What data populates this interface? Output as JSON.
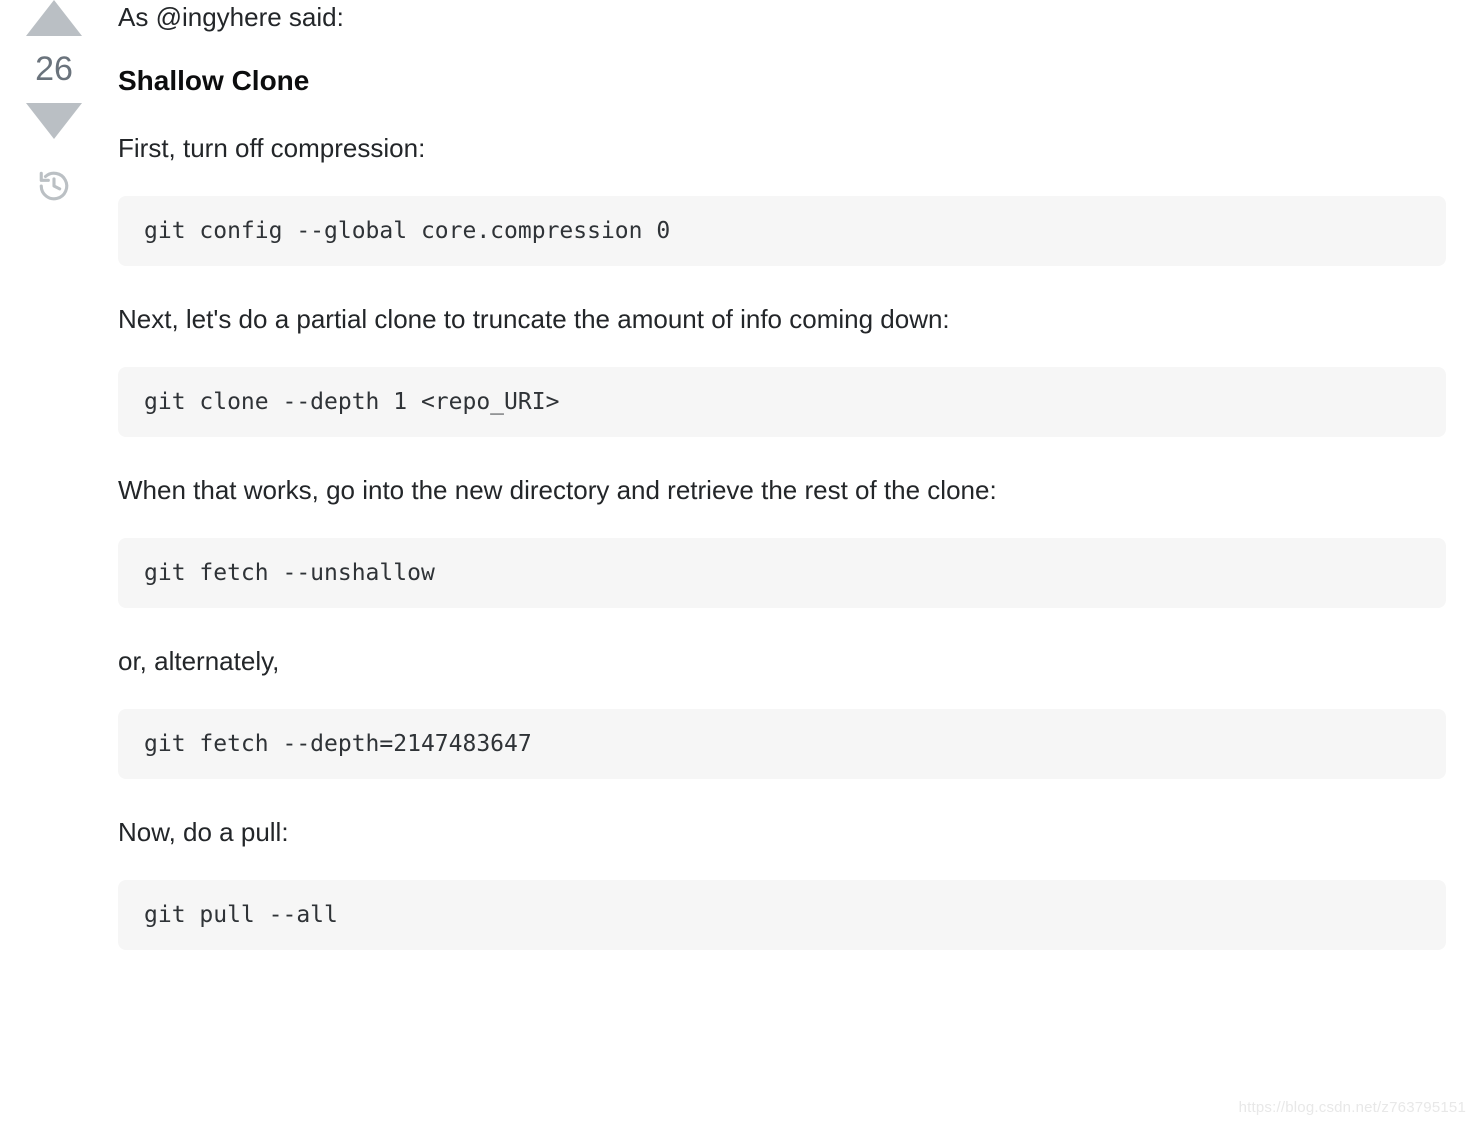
{
  "vote": {
    "count": "26"
  },
  "answer": {
    "intro": "As @ingyhere said:",
    "heading": "Shallow Clone",
    "p1": "First, turn off compression:",
    "code1": "git config --global core.compression 0",
    "p2": "Next, let's do a partial clone to truncate the amount of info coming down:",
    "code2": "git clone --depth 1 <repo_URI>",
    "p3": "When that works, go into the new directory and retrieve the rest of the clone:",
    "code3": "git fetch --unshallow",
    "p4": "or, alternately,",
    "code4": "git fetch --depth=2147483647",
    "p5": "Now, do a pull:",
    "code5": "git pull --all"
  },
  "watermark": "https://blog.csdn.net/z763795151"
}
